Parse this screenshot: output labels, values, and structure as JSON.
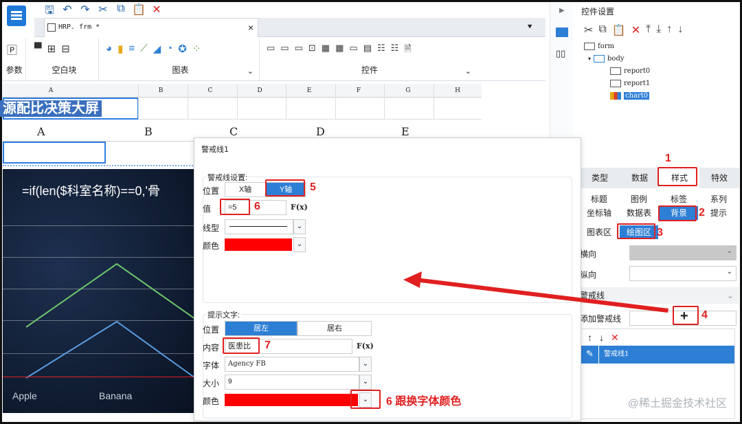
{
  "toolbar": {
    "tab_filename": "HRP. frm *",
    "groups": [
      {
        "label": "参数"
      },
      {
        "label": "空白块"
      },
      {
        "label": "图表"
      },
      {
        "label": "控件"
      }
    ]
  },
  "sheet": {
    "col_headers_top": [
      "A",
      "B",
      "C",
      "D",
      "E",
      "F",
      "G",
      "H"
    ],
    "title_cell": "源配比决策大屏",
    "col_headers_preview": [
      "A",
      "B",
      "C",
      "D",
      "E"
    ],
    "formula": "=if(len($科室名称)==0,'骨",
    "x_labels": [
      "Apple",
      "Banana"
    ]
  },
  "dialog": {
    "title": "警戒线1",
    "warning_settings": {
      "title": "警戒线设置:",
      "position_label": "位置",
      "position_options": [
        "X轴",
        "Y轴"
      ],
      "position_selected": "Y轴",
      "value_label": "值",
      "value": "=5",
      "linetype_label": "线型",
      "color_label": "颜色"
    },
    "hint_text": {
      "title": "提示文字:",
      "position_label": "位置",
      "position_options": [
        "居左",
        "居右"
      ],
      "position_selected": "居左",
      "content_label": "内容",
      "content": "医患比",
      "font_label": "字体",
      "font": "Agency FB",
      "size_label": "大小",
      "size": "9",
      "color_label": "颜色"
    },
    "fx": "F(x)"
  },
  "panel": {
    "title": "控件设置",
    "tree": [
      {
        "label": "form"
      },
      {
        "label": "body"
      },
      {
        "label": "report0"
      },
      {
        "label": "report1"
      },
      {
        "label": "chart0"
      }
    ],
    "tabs": [
      "类型",
      "数据",
      "样式",
      "特效"
    ],
    "active_tab": "样式",
    "subtabs": [
      "标题",
      "图例",
      "标签",
      "系列",
      "坐标轴",
      "数据表",
      "背景",
      "提示",
      "图表区",
      "绘图区"
    ],
    "horizontal_label": "横向",
    "vertical_label": "纵向",
    "warning_section": "警戒线",
    "add_warning_label": "添加警戒线",
    "list_item": "警戒线1"
  },
  "annotations": {
    "n1": "1",
    "n2": "2",
    "n3": "3",
    "n4": "4",
    "n5": "5",
    "n6": "6",
    "n7": "7",
    "n6b": "6 跟换字体颜色"
  },
  "watermark": "@稀土掘金技术社区",
  "colors": {
    "accent": "#2d7fd6",
    "annotation": "#e02020",
    "warning_color": "#ff0000"
  }
}
